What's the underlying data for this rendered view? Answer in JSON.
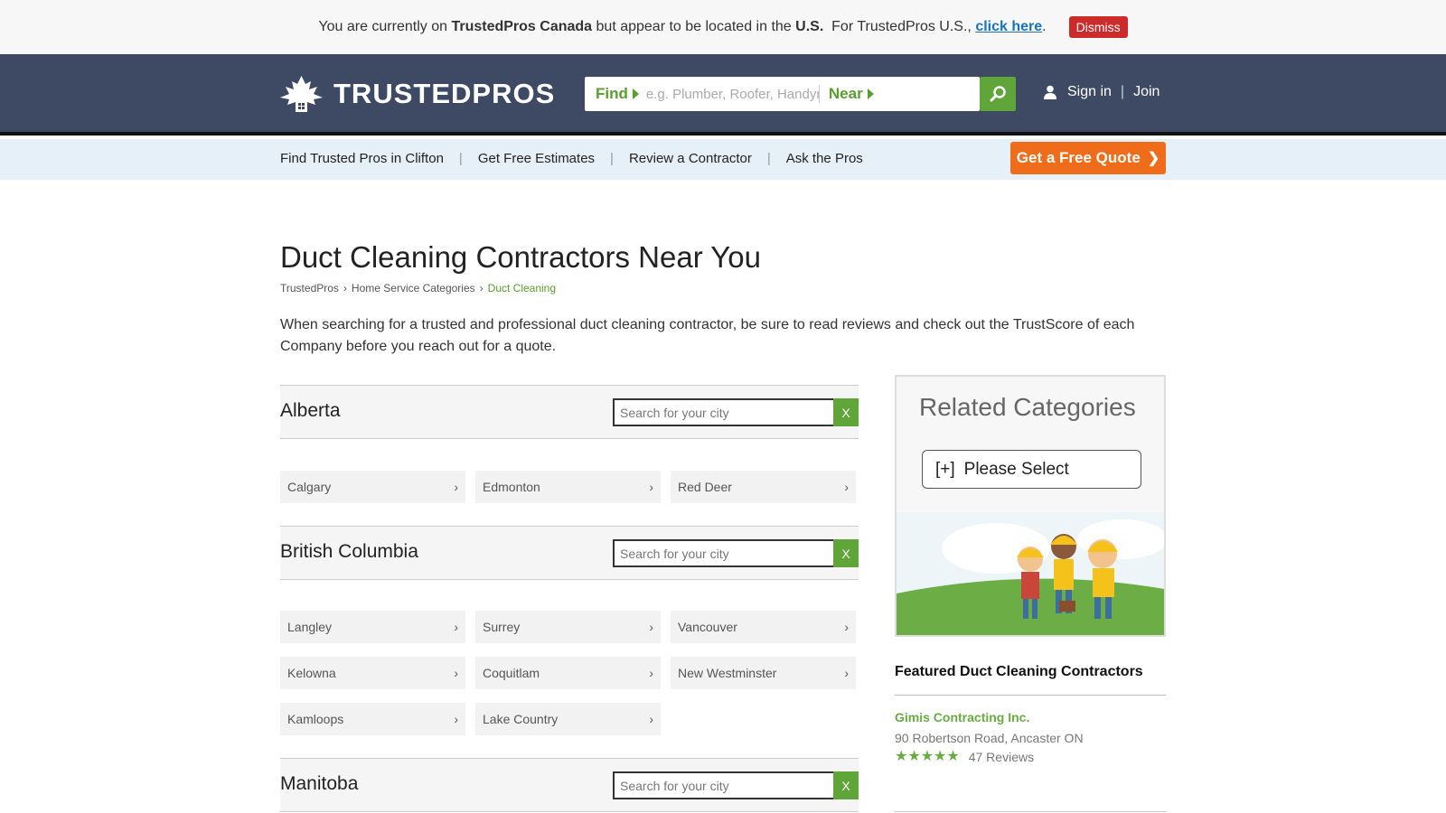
{
  "geo_banner": {
    "text_1": "You are currently on",
    "site_name": "TrustedPros Canada",
    "text_2": "but appear to be located in the",
    "country": "U.S.",
    "text_3": "For TrustedPros U.S.,",
    "link": "click here",
    "period": ".",
    "dismiss": "Dismiss"
  },
  "header": {
    "logo": "TRUSTEDPROS",
    "find_label": "Find",
    "find_placeholder": "e.g. Plumber, Roofer, Handyman",
    "near_label": "Near",
    "sign_in": "Sign in",
    "separator": "|",
    "join": "Join"
  },
  "subnav": {
    "items": [
      "Find Trusted Pros in Clifton",
      "Get Free Estimates",
      "Review a Contractor",
      "Ask the Pros"
    ],
    "separator": "|",
    "quote_button": "Get a Free Quote"
  },
  "main": {
    "title": "Duct Cleaning Contractors Near You",
    "breadcrumb": [
      "TrustedPros",
      "Home Service Categories",
      "Duct Cleaning"
    ],
    "intro": "When searching for a trusted and professional duct cleaning contractor, be sure to read reviews and check out the TrustScore of each Company before you reach out for a quote."
  },
  "provinces": [
    {
      "name": "Alberta",
      "search_placeholder": "Search for your city",
      "clear": "X",
      "cities": [
        "Calgary",
        "Edmonton",
        "Red Deer"
      ]
    },
    {
      "name": "British Columbia",
      "search_placeholder": "Search for your city",
      "clear": "X",
      "cities": [
        "Langley",
        "Surrey",
        "Vancouver",
        "Kelowna",
        "Coquitlam",
        "New Westminster",
        "Kamloops",
        "Lake Country"
      ]
    },
    {
      "name": "Manitoba",
      "search_placeholder": "Search for your city",
      "clear": "X",
      "cities": []
    }
  ],
  "sidebar": {
    "related_title": "Related Categories",
    "select_plus": "[+]",
    "select_label": "Please Select",
    "featured_title": "Featured Duct Cleaning Contractors",
    "featured": [
      {
        "name": "Gimis Contracting Inc.",
        "address": "90 Robertson Road, Ancaster ON",
        "rating": 5,
        "reviews": "47 Reviews"
      }
    ]
  },
  "colors": {
    "header_bg": "#3e4a63",
    "accent_green": "#5fa53a",
    "quote_orange": "#ef6c1b",
    "dismiss_red": "#cc2b2b",
    "subnav_bg": "#e6f0f8"
  },
  "icons": [
    "maple-leaf-house-logo-icon",
    "search-icon",
    "user-icon",
    "chevron-right-icon",
    "star-icon"
  ]
}
